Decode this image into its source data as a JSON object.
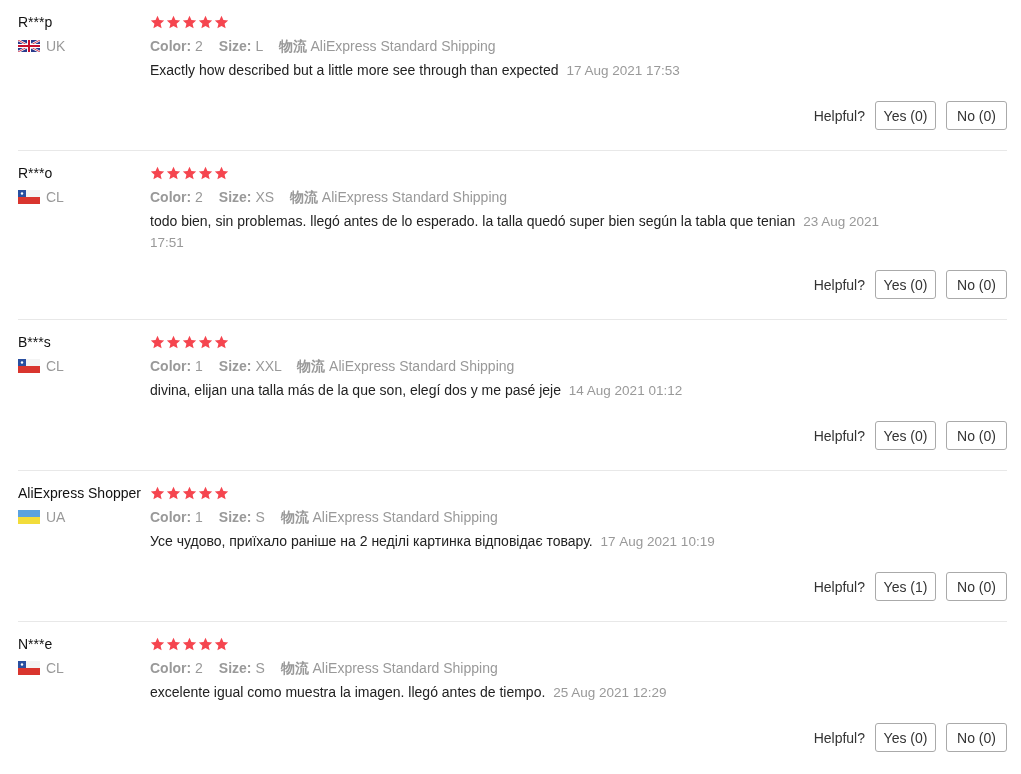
{
  "reviews": [
    {
      "name": "R***p",
      "kind": "uk",
      "country": "UK",
      "stars": 5,
      "color_label": "Color:",
      "color_value": "2",
      "size_label": "Size:",
      "size": "L",
      "shipping_label": "物流",
      "shipping": "AliExpress Standard Shipping",
      "comment": "Exactly how described but a little more see through than expected",
      "date": "17 Aug 2021 17:53",
      "helpful_label": "Helpful?",
      "yes": "Yes (0)",
      "no": "No (0)"
    },
    {
      "name": "R***o",
      "kind": "cl",
      "country": "CL",
      "stars": 5,
      "color_label": "Color:",
      "color_value": "2",
      "size_label": "Size:",
      "size": "XS",
      "shipping_label": "物流",
      "shipping": "AliExpress Standard Shipping",
      "comment": "todo bien, sin problemas. llegó antes de lo esperado. la talla quedó super bien según la tabla que tenian",
      "date": "23 Aug 2021 17:51",
      "helpful_label": "Helpful?",
      "yes": "Yes (0)",
      "no": "No (0)"
    },
    {
      "name": "B***s",
      "kind": "cl",
      "country": "CL",
      "stars": 5,
      "color_label": "Color:",
      "color_value": "1",
      "size_label": "Size:",
      "size": "XXL",
      "shipping_label": "物流",
      "shipping": "AliExpress Standard Shipping",
      "comment": "divina, elijan una talla más de la que son, elegí dos y me pasé jeje",
      "date": "14 Aug 2021 01:12",
      "helpful_label": "Helpful?",
      "yes": "Yes (0)",
      "no": "No (0)"
    },
    {
      "name": "AliExpress Shopper",
      "kind": "ua",
      "country": "UA",
      "stars": 5,
      "color_label": "Color:",
      "color_value": "1",
      "size_label": "Size:",
      "size": "S",
      "shipping_label": "物流",
      "shipping": "AliExpress Standard Shipping",
      "comment": "Усе чудово, приїхало раніше на 2 неділі картинка відповідає товару.",
      "date": "17 Aug 2021 10:19",
      "helpful_label": "Helpful?",
      "yes": "Yes (1)",
      "no": "No (0)"
    },
    {
      "name": "N***e",
      "kind": "cl",
      "country": "CL",
      "stars": 5,
      "color_label": "Color:",
      "color_value": "2",
      "size_label": "Size:",
      "size": "S",
      "shipping_label": "物流",
      "shipping": "AliExpress Standard Shipping",
      "comment": "excelente igual como muestra la imagen. llegó antes de tiempo.",
      "date": "25 Aug 2021 12:29",
      "helpful_label": "Helpful?",
      "yes": "Yes (0)",
      "no": "No (0)"
    }
  ]
}
